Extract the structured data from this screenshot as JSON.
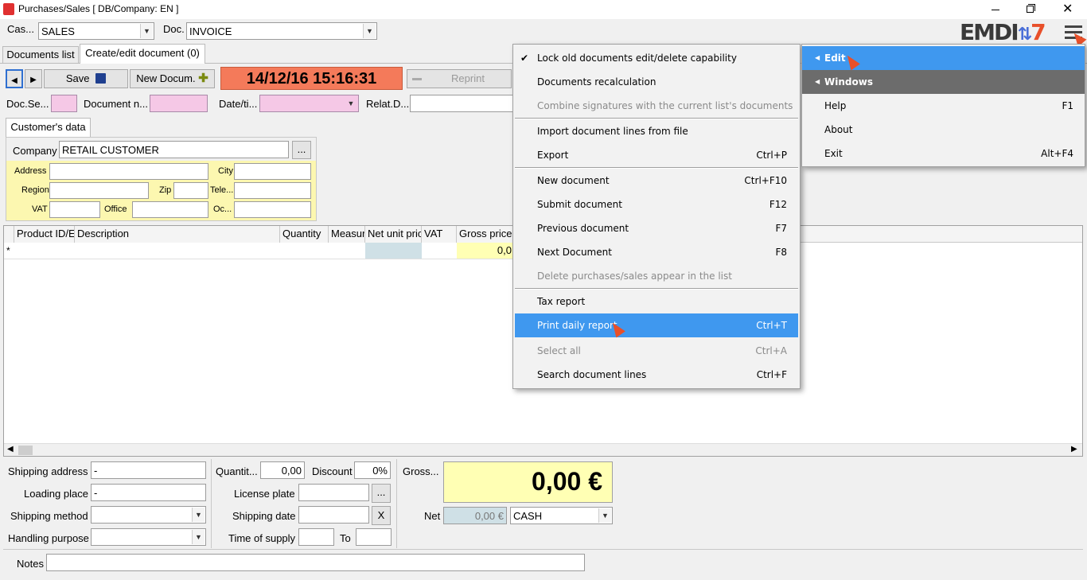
{
  "window": {
    "title": "Purchases/Sales   [ DB/Company: EN ]",
    "logo_text_a": "EMDI",
    "logo_text_b": "7"
  },
  "toolbar": {
    "cash_label": "Cas...",
    "cash_value": "SALES",
    "doc_label": "Doc.",
    "doc_value": "INVOICE"
  },
  "tabs": {
    "documents_list": "Documents list",
    "create_edit": "Create/edit document (0)"
  },
  "actions": {
    "save": "Save",
    "new_document": "New Docum.",
    "datetime": "14/12/16 15:16:31",
    "reprint": "Reprint"
  },
  "docfields": {
    "doc_series": "Doc.Se...",
    "document_no": "Document n...",
    "date_time": "Date/ti...",
    "related": "Relat.D..."
  },
  "customer": {
    "tab": "Customer's data",
    "company_label": "Company",
    "company_value": "RETAIL CUSTOMER",
    "browse": "...",
    "address": "Address",
    "city": "City",
    "region": "Region",
    "zip": "Zip",
    "telephone": "Tele...",
    "vat": "VAT",
    "office": "Office",
    "occupation": "Oc..."
  },
  "grid": {
    "columns": [
      "Product ID/E",
      "Description",
      "Quantity",
      "Measur",
      "Net unit pric",
      "VAT",
      "Gross price"
    ],
    "new_row_marker": "*",
    "gross_value": "0,0"
  },
  "footer": {
    "shipping_address_label": "Shipping address",
    "shipping_address_value": "-",
    "loading_place_label": "Loading place",
    "loading_place_value": "-",
    "shipping_method_label": "Shipping method",
    "handling_purpose_label": "Handling purpose",
    "quantity_label": "Quantit...",
    "quantity_value": "0,00",
    "discount_label": "Discount",
    "discount_value": "0%",
    "license_plate_label": "License plate",
    "license_browse": "...",
    "shipping_date_label": "Shipping date",
    "shipping_date_clear": "X",
    "time_of_supply_label": "Time of supply",
    "to_label": "To",
    "gross_label": "Gross...",
    "gross_total": "0,00 €",
    "net_label": "Net",
    "net_value": "0,00 €",
    "payment_value": "CASH",
    "notes_label": "Notes"
  },
  "edit_menu": {
    "items": [
      {
        "label": "Lock old documents edit/delete capability",
        "shortcut": "",
        "checked": true,
        "disabled": false
      },
      {
        "label": "Documents recalculation",
        "shortcut": "",
        "disabled": false
      },
      {
        "label": "Combine signatures with the current list's documents",
        "shortcut": "",
        "disabled": true
      },
      {
        "label": "Import document lines from file",
        "shortcut": "",
        "disabled": false
      },
      {
        "label": "Export",
        "shortcut": "Ctrl+P",
        "disabled": false
      },
      {
        "label": "New document",
        "shortcut": "Ctrl+F10",
        "disabled": false
      },
      {
        "label": "Submit document",
        "shortcut": "F12",
        "disabled": false
      },
      {
        "label": "Previous document",
        "shortcut": "F7",
        "disabled": false
      },
      {
        "label": "Next Document",
        "shortcut": "F8",
        "disabled": false
      },
      {
        "label": "Delete purchases/sales appear in the list",
        "shortcut": "",
        "disabled": true
      },
      {
        "label": "Tax report",
        "shortcut": "",
        "disabled": false
      },
      {
        "label": "Print daily report",
        "shortcut": "Ctrl+T",
        "highlighted": true
      },
      {
        "label": "Select all",
        "shortcut": "Ctrl+A",
        "disabled": true
      },
      {
        "label": "Search document lines",
        "shortcut": "Ctrl+F",
        "disabled": false
      }
    ]
  },
  "main_menu": {
    "edit": "Edit",
    "windows": "Windows",
    "help": "Help",
    "help_sc": "F1",
    "about": "About",
    "exit": "Exit",
    "exit_sc": "Alt+F4"
  },
  "colors": {
    "highlight": "#3f98ef",
    "datetime_bg": "#f47a5a",
    "customer_bg": "#fcf7b0",
    "pink_field": "#f5c8e6",
    "gross_total_bg": "#ffffb4"
  }
}
